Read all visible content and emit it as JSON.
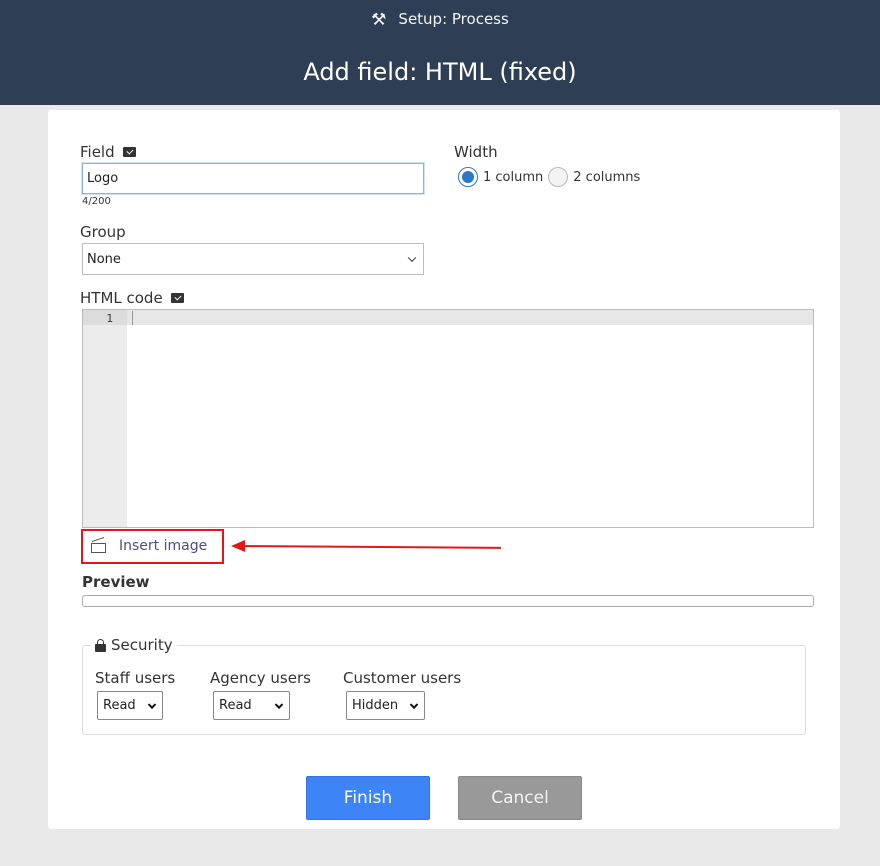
{
  "header": {
    "breadcrumb": "Setup: Process",
    "title": "Add field: HTML (fixed)"
  },
  "field": {
    "label": "Field",
    "value": "Logo",
    "counter": "4/200"
  },
  "width": {
    "label": "Width",
    "options": [
      "1 column",
      "2 columns"
    ],
    "selected": "1 column"
  },
  "group": {
    "label": "Group",
    "value": "None"
  },
  "html_code": {
    "label": "HTML code",
    "line_number": "1"
  },
  "insert_image": {
    "label": "Insert image"
  },
  "preview": {
    "label": "Preview"
  },
  "security": {
    "legend": "Security",
    "staff": {
      "label": "Staff users",
      "value": "Read"
    },
    "agency": {
      "label": "Agency users",
      "value": "Read"
    },
    "customer": {
      "label": "Customer users",
      "value": "Hidden"
    }
  },
  "buttons": {
    "finish": "Finish",
    "cancel": "Cancel"
  },
  "colors": {
    "header_bg": "#2e3e54",
    "primary": "#3d84f6",
    "annotation": "#e01818"
  }
}
